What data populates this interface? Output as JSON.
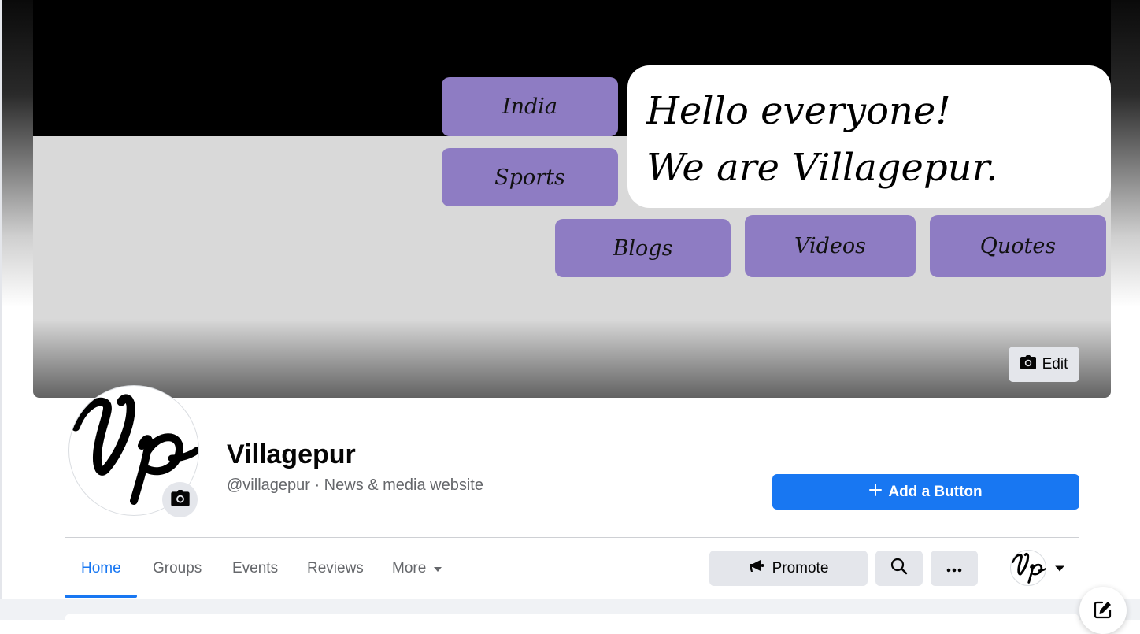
{
  "cover": {
    "tiles": {
      "india": "India",
      "sports": "Sports",
      "blogs": "Blogs",
      "videos": "Videos",
      "quotes": "Quotes"
    },
    "speech_line1": "Hello everyone!",
    "speech_line2": "We are Villagepur.",
    "edit_label": "Edit",
    "tile_color": "#8e7cc3"
  },
  "profile": {
    "name": "Villagepur",
    "handle_category": "@villagepur · News & media website",
    "add_button_label": "Add a Button",
    "logo_text": "Vp"
  },
  "tabs": [
    {
      "label": "Home",
      "active": true
    },
    {
      "label": "Groups"
    },
    {
      "label": "Events"
    },
    {
      "label": "Reviews"
    },
    {
      "label": "More"
    }
  ],
  "actions": {
    "promote_label": "Promote"
  },
  "colors": {
    "accent": "#1877f2",
    "button_gray": "#e4e6eb",
    "muted_text": "#65676b"
  },
  "icons": [
    "camera-icon",
    "plus-icon",
    "megaphone-icon",
    "search-icon",
    "more-dots-icon",
    "caret-down-icon",
    "compose-icon"
  ]
}
